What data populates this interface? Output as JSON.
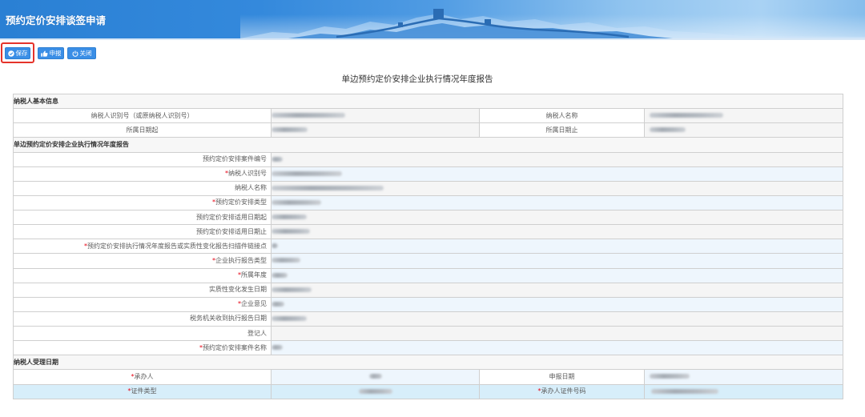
{
  "window": {
    "title": "预约定价安排谈签申请"
  },
  "toolbar": {
    "buttons": [
      {
        "label": "保存",
        "icon": "check-circle-icon"
      },
      {
        "label": "申报",
        "icon": "thumbs-up-icon"
      },
      {
        "label": "关闭",
        "icon": "power-icon"
      }
    ]
  },
  "report": {
    "title": "单边预约定价安排企业执行情况年度报告",
    "required_mark": "*",
    "taxpayer_info": {
      "title": "纳税人基本信息",
      "rows": [
        {
          "left_label": "纳税人识别号（或原纳税人识别号）",
          "right_label": "纳税人名称"
        },
        {
          "left_label": "所属日期起",
          "right_label": "所属日期止"
        }
      ]
    },
    "annual_report": {
      "title": "单边预约定价安排企业执行情况年度报告",
      "fields": [
        {
          "label": "预约定价安排案件编号",
          "required": false
        },
        {
          "label": "纳税人识别号",
          "required": true
        },
        {
          "label": "纳税人名称",
          "required": false
        },
        {
          "label": "预约定价安排类型",
          "required": true
        },
        {
          "label": "预约定价安排适用日期起",
          "required": false
        },
        {
          "label": "预约定价安排适用日期止",
          "required": false
        },
        {
          "label": "预约定价安排执行情况年度报告或实质性变化报告扫描件链接点",
          "required": true
        },
        {
          "label": "企业执行报告类型",
          "required": true
        },
        {
          "label": "所属年度",
          "required": true
        },
        {
          "label": "实质性变化发生日期",
          "required": false
        },
        {
          "label": "企业意见",
          "required": true
        },
        {
          "label": "税务机关收到执行报告日期",
          "required": false
        },
        {
          "label": "登记人",
          "required": false
        },
        {
          "label": "预约定价安排案件名称",
          "required": true
        }
      ]
    },
    "acceptance": {
      "title": "纳税人受理日期",
      "rows": [
        {
          "left_label": "承办人",
          "left_required": true,
          "right_label": "申报日期",
          "right_required": false
        },
        {
          "left_label": "证件类型",
          "left_required": true,
          "right_label": "承办人证件号码",
          "right_required": true
        }
      ]
    }
  },
  "colors": {
    "banner_blue": "#2f86d9",
    "button_blue": "#3a8ee6",
    "required_red": "#e60012",
    "highlight_red": "#e5332a",
    "required_field_bg": "#eef6fd",
    "readonly_field_bg": "#f5f5f5",
    "selected_row_bg": "#d7eefa"
  }
}
